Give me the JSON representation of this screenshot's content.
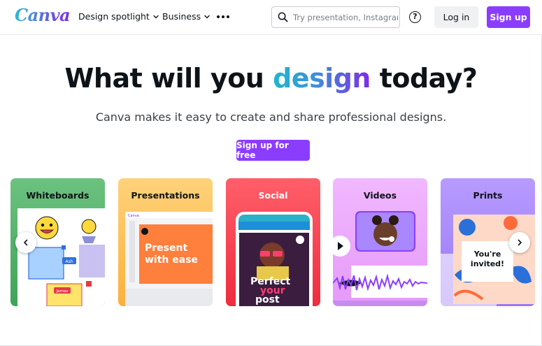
{
  "nav": {
    "logo": "Canva",
    "items": [
      {
        "label": "Design spotlight"
      },
      {
        "label": "Business"
      }
    ],
    "more_icon": "more-horizontal-icon",
    "search": {
      "placeholder": "Try presentation, Instagram",
      "value": ""
    },
    "help_icon": "help-circle-icon",
    "login_label": "Log in",
    "signup_label": "Sign up"
  },
  "hero": {
    "title_before": "What will you ",
    "title_accent": "design",
    "title_after": " today?",
    "subtitle": "Canva makes it easy to create and share professional designs.",
    "cta_label": "Sign up for free"
  },
  "cards": [
    {
      "title": "Whiteboards",
      "tag_a": "Ash",
      "tag_b": "James"
    },
    {
      "title": "Presentations",
      "app_label": "Canva",
      "slide_text_1": "Present",
      "slide_text_2": "with ease"
    },
    {
      "title": "Social",
      "post_text_1": "Perfect",
      "post_text_2": "your",
      "post_text_3": "post"
    },
    {
      "title": "Videos"
    },
    {
      "title": "Prints",
      "card_text_1": "You're",
      "card_text_2": "invited!"
    }
  ],
  "carousel": {
    "prev_icon": "chevron-left-icon",
    "next_icon": "chevron-right-icon"
  },
  "colors": {
    "brand": "#8b3dff",
    "text": "#0e1318"
  }
}
